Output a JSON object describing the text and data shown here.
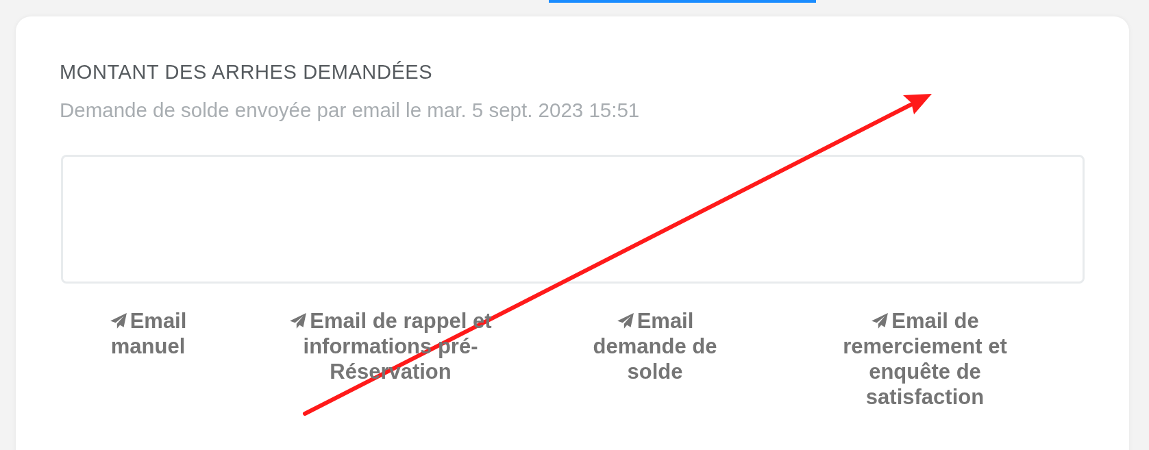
{
  "section": {
    "title": "MONTANT DES ARRHES DEMANDÉES",
    "subtitle": "Demande de solde envoyée par email le mar. 5 sept. 2023 15:51"
  },
  "email_buttons": [
    {
      "label": "Email manuel"
    },
    {
      "label": "Email de rappel et informations pré-Réservation"
    },
    {
      "label": "Email demande de solde"
    },
    {
      "label": "Email de remerciement et enquête de satisfaction"
    }
  ]
}
